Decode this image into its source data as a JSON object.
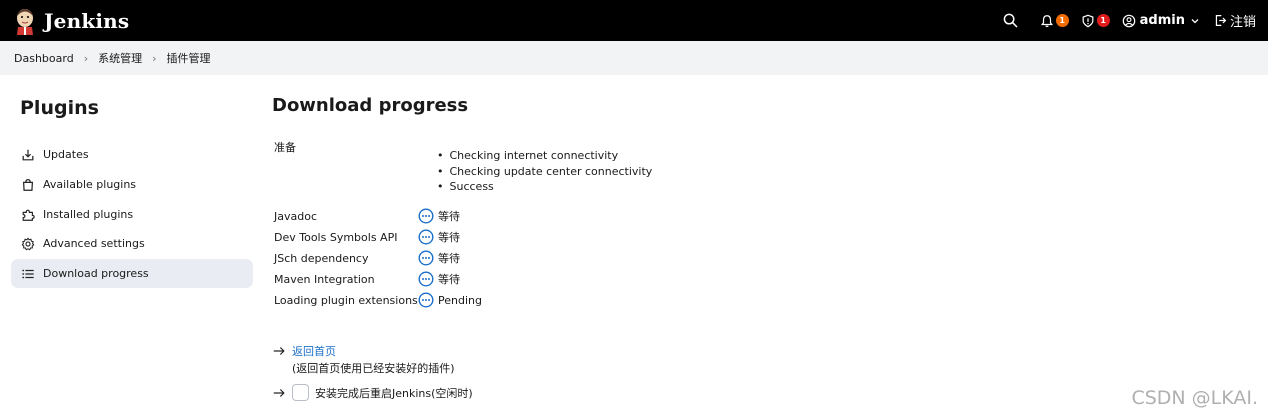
{
  "header": {
    "brand": "Jenkins",
    "notifications_count": "1",
    "security_count": "1",
    "user": "admin",
    "logout": "注销"
  },
  "breadcrumb": [
    "Dashboard",
    "系统管理",
    "插件管理"
  ],
  "sidebar": {
    "title": "Plugins",
    "items": [
      {
        "label": "Updates",
        "icon": "download-icon"
      },
      {
        "label": "Available plugins",
        "icon": "shopping-bag-icon"
      },
      {
        "label": "Installed plugins",
        "icon": "puzzle-icon"
      },
      {
        "label": "Advanced settings",
        "icon": "gear-icon"
      },
      {
        "label": "Download progress",
        "icon": "list-icon",
        "active": true
      }
    ]
  },
  "main": {
    "title": "Download progress",
    "prepare_label": "准备",
    "checks": [
      "Checking internet connectivity",
      "Checking update center connectivity",
      "Success"
    ],
    "plugins": [
      {
        "name": "Javadoc",
        "status": "等待"
      },
      {
        "name": "Dev Tools Symbols API",
        "status": "等待"
      },
      {
        "name": "JSch dependency",
        "status": "等待"
      },
      {
        "name": "Maven Integration",
        "status": "等待"
      },
      {
        "name": "Loading plugin extensions",
        "status": "Pending"
      }
    ],
    "home_link": "返回首页",
    "home_note": "(返回首页使用已经安装好的插件)",
    "restart_label": "安装完成后重启Jenkins(空闲时)"
  },
  "watermark": "CSDN @LKAI.",
  "colors": {
    "header_bg": "#000000",
    "accent_link": "#1b6fc8",
    "badge_orange": "#f26c00",
    "badge_red": "#e21c1c"
  }
}
